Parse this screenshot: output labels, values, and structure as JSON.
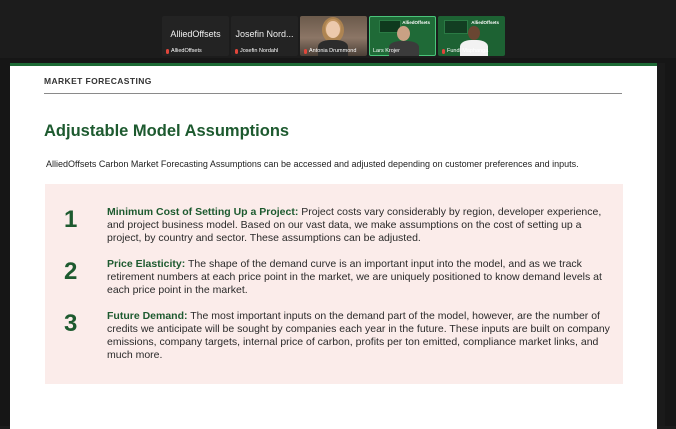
{
  "participants": [
    {
      "big": "AlliedOffsets",
      "caption": "AlliedOffsets",
      "video": false
    },
    {
      "big": "Josefin Nord...",
      "caption": "Josefin Nordahl",
      "video": false
    },
    {
      "big": "",
      "caption": "Antonia Drummond",
      "video": true
    },
    {
      "big": "",
      "caption": "Lars Krojer",
      "video": true
    },
    {
      "big": "",
      "caption": "Fundi Maphanga",
      "video": true
    }
  ],
  "tile_logo": "AlliedOffsets",
  "slide": {
    "eyebrow": "MARKET FORECASTING",
    "title": "Adjustable Model Assumptions",
    "intro": "AlliedOffsets Carbon Market Forecasting Assumptions can be accessed and adjusted depending on customer preferences and inputs.",
    "items": [
      {
        "number": "1",
        "heading": "Minimum Cost of Setting Up a Project:",
        "body": " Project costs vary considerably by region, developer experience, and project business model. Based on our vast data, we make assumptions on the cost of setting up a project, by country and sector. These assumptions can be adjusted."
      },
      {
        "number": "2",
        "heading": "Price Elasticity:",
        "body": " The shape of the demand curve is an important input into the model, and as we track retirement numbers at each price point in the market, we are uniquely positioned to know demand levels at each price point in the market."
      },
      {
        "number": "3",
        "heading": "Future Demand:",
        "body": " The most important inputs on the demand part of the model, however, are the number of credits we anticipate will be sought by companies each year in the future. These inputs are built on company emissions, company targets, internal price of carbon, profits per ton emitted, compliance market links, and much more."
      }
    ]
  },
  "colors": {
    "accent_green": "#1d5a2f",
    "panel_pink": "#fbecea",
    "speaking_outline": "#4ac47a"
  }
}
